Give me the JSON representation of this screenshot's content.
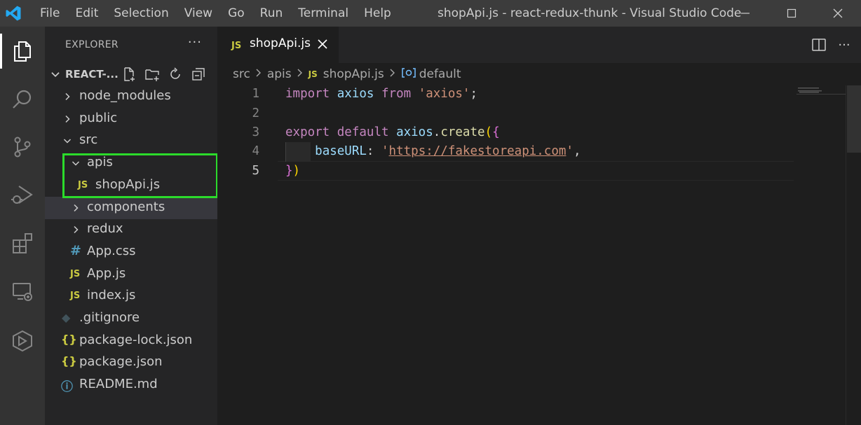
{
  "window": {
    "title": "shopApi.js - react-redux-thunk - Visual Studio Code"
  },
  "menu": [
    "File",
    "Edit",
    "Selection",
    "View",
    "Go",
    "Run",
    "Terminal",
    "Help"
  ],
  "sidebar": {
    "header": "EXPLORER",
    "more": "···",
    "section_label": "REACT-...",
    "tree": [
      {
        "name": "node_modules",
        "type": "folder"
      },
      {
        "name": "public",
        "type": "folder"
      },
      {
        "name": "src",
        "type": "folder-open"
      },
      {
        "name": "apis",
        "type": "folder-open"
      },
      {
        "name": "shopApi.js",
        "type": "js",
        "badge": "JS"
      },
      {
        "name": "components",
        "type": "folder"
      },
      {
        "name": "redux",
        "type": "folder"
      },
      {
        "name": "App.css",
        "type": "css",
        "badge": "#"
      },
      {
        "name": "App.js",
        "type": "js",
        "badge": "JS"
      },
      {
        "name": "index.js",
        "type": "js",
        "badge": "JS"
      },
      {
        "name": ".gitignore",
        "type": "git"
      },
      {
        "name": "package-lock.json",
        "type": "json",
        "badge": "{}"
      },
      {
        "name": "package.json",
        "type": "json",
        "badge": "{}"
      },
      {
        "name": "README.md",
        "type": "info",
        "badge": "ⓘ"
      }
    ]
  },
  "tabs": [
    {
      "label": "shopApi.js",
      "badge": "JS"
    }
  ],
  "breadcrumb": {
    "items": [
      "src",
      "apis",
      "shopApi.js",
      "default"
    ],
    "js_badge": "JS",
    "symbol_icon": "{⊙}"
  },
  "editor": {
    "line_numbers": [
      "1",
      "2",
      "3",
      "4",
      "5"
    ],
    "active_line": "5",
    "code": {
      "l1_import": "import",
      "l1_axios": "axios",
      "l1_from": "from",
      "l1_str": "'axios'",
      "l1_semi": ";",
      "l3_export": "export",
      "l3_default": "default",
      "l3_axios": "axios",
      "l3_dot": ".",
      "l3_create": "create",
      "l3_paren": "(",
      "l3_brace": "{",
      "l4_key": "baseURL",
      "l4_colon": ": ",
      "l4_q1": "'",
      "l4_url": "https://fakestoreapi.com",
      "l4_q2": "'",
      "l4_comma": ",",
      "l5_brace": "}",
      "l5_paren": ")"
    }
  },
  "colors": {
    "accent_vscode": "#23a9f2",
    "highlight_box": "#2bdb2b",
    "js_badge": "#cbcb41"
  }
}
